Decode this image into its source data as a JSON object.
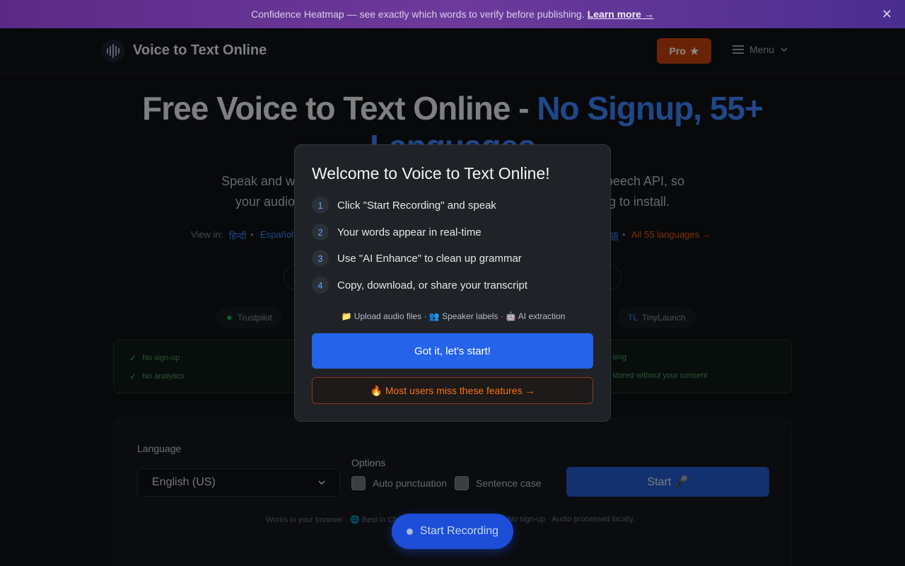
{
  "banner": {
    "text": "Confidence Heatmap — see exactly which words to verify before publishing.",
    "link": "Learn more →",
    "close_icon": "✕"
  },
  "header": {
    "brand": "Voice to Text Online",
    "pro_label": "Pro",
    "pro_icon": "★",
    "menu_label": "Menu",
    "logo_icon": "waveform-icon"
  },
  "hero": {
    "title_main": "Free Voice to Text Online - ",
    "title_accent": "No Signup, 55+ Languages",
    "subtitle_line1_left": "Speak and wa",
    "subtitle_line1_right": "peech API, so",
    "subtitle_line2_left": "your audio",
    "subtitle_line2_right": "g to install."
  },
  "languages": {
    "view_in": "View in:",
    "items": [
      "हिन्दी",
      "Español",
      "語"
    ],
    "separator": "•",
    "all_link": "All 55 languages →"
  },
  "badges": {
    "trustpilot": "Trustpilot",
    "tinylaunch": "TinyLaunch",
    "tinylaunch_prefix": "TL",
    "trustpilot_icon": "★"
  },
  "privacy": {
    "items": [
      "No sign-up",
      "No analytics",
      "sing",
      "stored without your consent"
    ],
    "check_icon": "✓"
  },
  "app": {
    "language_label": "Language",
    "language_value": "English (US)",
    "options_label": "Options",
    "auto_punct": "Auto punctuation",
    "sentence_case": "Sentence case",
    "start_label": "Start 🎤",
    "foot_left": "Works in your browser · 🌐 Best in Ch",
    "foot_right": "No sign-up · Audio processed locally."
  },
  "modal": {
    "title": "Welcome to Voice to Text Online!",
    "steps": [
      {
        "num": "1",
        "text": "Click \"Start Recording\" and speak"
      },
      {
        "num": "2",
        "text": "Your words appear in real-time"
      },
      {
        "num": "3",
        "text": "Use \"AI Enhance\" to clean up grammar"
      },
      {
        "num": "4",
        "text": "Copy, download, or share your transcript"
      }
    ],
    "features": "📁 Upload audio files · 👥 Speaker labels · 🤖 AI extraction",
    "primary_button": "Got it, let's start!",
    "secondary_button": "🔥 Most users miss these features →"
  },
  "record": {
    "label": "Start Recording"
  }
}
